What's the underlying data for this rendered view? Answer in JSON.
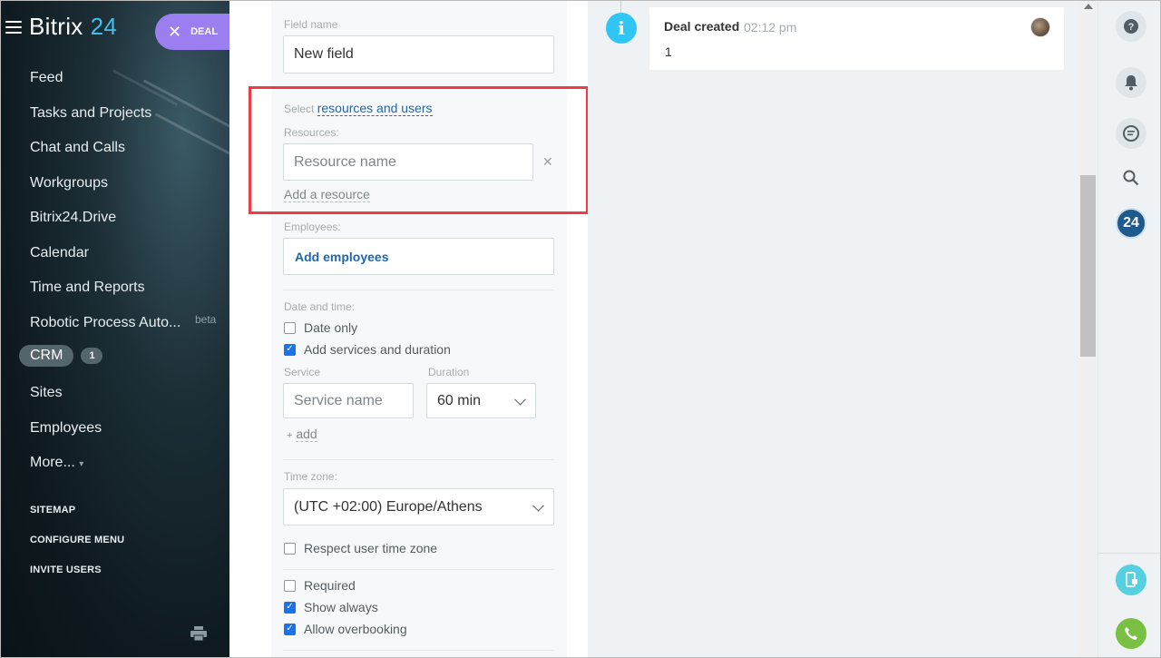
{
  "sidebar": {
    "logo_main": "Bitrix",
    "logo_num": "24",
    "deal_pill": "DEAL",
    "items": [
      {
        "label": "Feed"
      },
      {
        "label": "Tasks and Projects"
      },
      {
        "label": "Chat and Calls"
      },
      {
        "label": "Workgroups"
      },
      {
        "label": "Bitrix24.Drive"
      },
      {
        "label": "Calendar"
      },
      {
        "label": "Time and Reports"
      },
      {
        "label": "Robotic Process Auto...",
        "badge": "beta"
      }
    ],
    "crm": {
      "label": "CRM",
      "count": "1"
    },
    "items2": [
      {
        "label": "Sites"
      },
      {
        "label": "Employees"
      },
      {
        "label": "More..."
      }
    ],
    "links": [
      "SITEMAP",
      "CONFIGURE MENU",
      "INVITE USERS"
    ]
  },
  "form": {
    "field_name_label": "Field name",
    "field_name_value": "New field",
    "select_prefix": "Select",
    "select_link": "resources and users",
    "resources_label": "Resources:",
    "resource_placeholder": "Resource name",
    "add_resource": "Add a resource",
    "employees_label": "Employees:",
    "add_employees": "Add employees",
    "datetime_label": "Date and time:",
    "date_only": "Date only",
    "add_services": "Add services and duration",
    "service_label": "Service",
    "duration_label": "Duration",
    "service_placeholder": "Service name",
    "duration_value": "60 min",
    "add_link": "add",
    "timezone_label": "Time zone:",
    "timezone_value": "(UTC +02:00) Europe/Athens",
    "respect_tz": "Respect user time zone",
    "required": "Required",
    "show_always": "Show always",
    "allow_overbooking": "Allow overbooking"
  },
  "checkbox_states": {
    "date_only": false,
    "add_services": true,
    "respect_tz": false,
    "required": false,
    "show_always": true,
    "allow_overbooking": true
  },
  "timeline": {
    "event_title": "Deal created",
    "event_time": "02:12 pm",
    "event_value": "1"
  },
  "rail": {
    "counter_label": "24"
  },
  "colors": {
    "accent_blue": "#2067b0",
    "highlight_red": "#ee3b45",
    "deal_purple": "#9b7ff0",
    "info_cyan": "#2fc6f6",
    "bitrix_badge": "#1f5a8f",
    "phone_green": "#7ac143"
  }
}
